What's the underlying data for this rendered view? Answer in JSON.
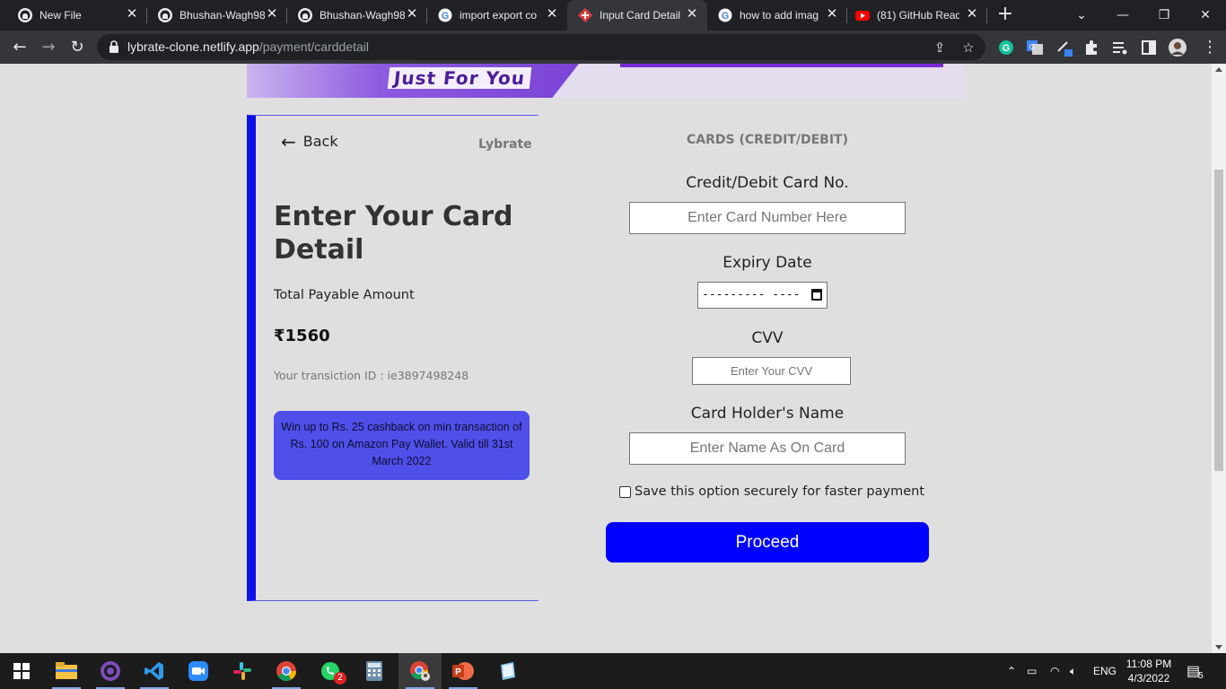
{
  "browser": {
    "tabs": [
      {
        "title": "New File",
        "icon": "github-icon",
        "active": false
      },
      {
        "title": "Bhushan-Wagh98",
        "icon": "github-icon",
        "active": false
      },
      {
        "title": "Bhushan-Wagh98",
        "icon": "github-icon",
        "active": false
      },
      {
        "title": "import export co",
        "icon": "google-icon",
        "active": false
      },
      {
        "title": "Input Card Detail",
        "icon": "lybrate-icon",
        "active": true
      },
      {
        "title": "how to add imag",
        "icon": "google-icon",
        "active": false
      },
      {
        "title": "(81) GitHub Read",
        "icon": "youtube-icon",
        "active": false
      }
    ],
    "url_host": "lybrate-clone.netlify.app",
    "url_path": "/payment/carddetail"
  },
  "page": {
    "banner_text": "Just For You",
    "back_label": "Back",
    "brand": "Lybrate",
    "heading": "Enter Your Card Detail",
    "pay_label": "Total Payable Amount",
    "amount": "₹1560",
    "txn_label": "Your transiction ID : ie3897498248",
    "offer_text": "Win up to Rs. 25 cashback on min transaction of Rs. 100 on Amazon Pay Wallet. Valid till 31st March 2022",
    "cards_title": "CARDS (CREDIT/DEBIT)",
    "card_no_label": "Credit/Debit Card No.",
    "card_no_placeholder": "Enter Card Number Here",
    "expiry_label": "Expiry Date",
    "expiry_value": "---------  ----",
    "cvv_label": "CVV",
    "cvv_placeholder": "Enter Your CVV",
    "holder_label": "Card Holder's Name",
    "holder_placeholder": "Enter Name As On Card",
    "save_label": "Save this option securely for faster payment",
    "proceed_label": "Proceed"
  },
  "taskbar": {
    "apps": [
      "start-icon",
      "file-explorer-icon",
      "github-desktop-icon",
      "vscode-icon",
      "zoom-icon",
      "slack-icon",
      "chrome-icon",
      "whatsapp-icon",
      "calculator-icon",
      "chrome-profile-icon",
      "powerpoint-icon",
      "notepad-icon"
    ],
    "whatsapp_badge": "2",
    "lang": "ENG",
    "time": "11:08 PM",
    "date": "4/3/2022",
    "notif_count": "5"
  },
  "colors": {
    "accent": "#0000ff",
    "offer_bg": "#4f4fea",
    "card_border": "#1010e8"
  }
}
